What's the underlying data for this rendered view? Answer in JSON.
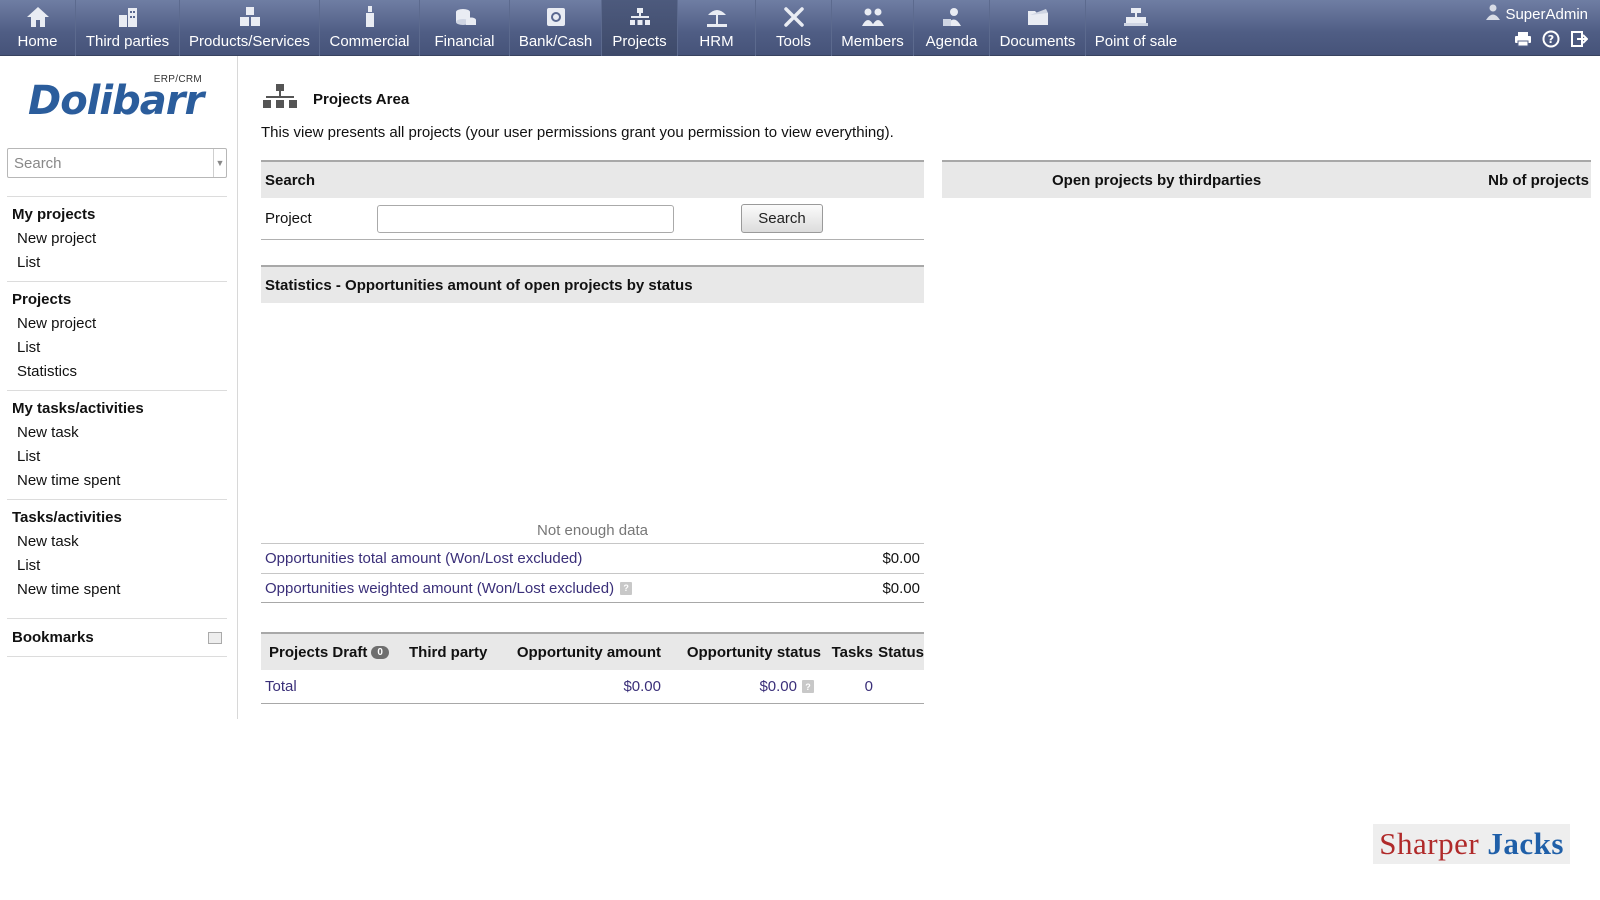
{
  "nav": {
    "items": [
      {
        "label": "Home",
        "icon": "home-icon"
      },
      {
        "label": "Third parties",
        "icon": "building-icon"
      },
      {
        "label": "Products/Services",
        "icon": "boxes-icon"
      },
      {
        "label": "Commercial",
        "icon": "bottle-icon"
      },
      {
        "label": "Financial",
        "icon": "coins-icon"
      },
      {
        "label": "Bank/Cash",
        "icon": "safe-icon"
      },
      {
        "label": "Projects",
        "icon": "org-chart-icon",
        "active": true
      },
      {
        "label": "HRM",
        "icon": "beach-icon"
      },
      {
        "label": "Tools",
        "icon": "wrench-icon"
      },
      {
        "label": "Members",
        "icon": "group-icon"
      },
      {
        "label": "Agenda",
        "icon": "agenda-icon"
      },
      {
        "label": "Documents",
        "icon": "folder-icon"
      },
      {
        "label": "Point of sale",
        "icon": "cash-register-icon"
      }
    ],
    "user": "SuperAdmin"
  },
  "sidebar": {
    "logo_word": "Dolibarr",
    "logo_tag": "ERP/CRM",
    "search_placeholder": "Search",
    "blocks": [
      {
        "title": "My projects",
        "items": [
          "New project",
          "List"
        ]
      },
      {
        "title": "Projects",
        "items": [
          "New project",
          "List",
          "Statistics"
        ]
      },
      {
        "title": "My tasks/activities",
        "items": [
          "New task",
          "List",
          "New time spent"
        ]
      },
      {
        "title": "Tasks/activities",
        "items": [
          "New task",
          "List",
          "New time spent"
        ]
      }
    ],
    "bookmarks": "Bookmarks"
  },
  "main": {
    "title": "Projects Area",
    "intro": "This view presents all projects (your user permissions grant you permission to view everything).",
    "search": {
      "header": "Search",
      "label": "Project",
      "value": "",
      "button": "Search"
    },
    "stats": {
      "header": "Statistics - Opportunities amount of open projects by status",
      "no_data": "Not enough data",
      "rows": [
        {
          "label": "Opportunities total amount (Won/Lost excluded)",
          "value": "$0.00"
        },
        {
          "label": "Opportunities weighted amount (Won/Lost excluded)",
          "value": "$0.00"
        }
      ]
    },
    "draft": {
      "title": "Projects Draft",
      "count": "0",
      "columns": [
        "Third party",
        "Opportunity amount",
        "Opportunity status",
        "Tasks",
        "Status"
      ],
      "total_label": "Total",
      "total_amount": "$0.00",
      "total_status_amount": "$0.00",
      "total_tasks": "0"
    },
    "thirdparties": {
      "col1": "Open projects by thirdparties",
      "col2": "Nb of projects"
    }
  },
  "watermark": {
    "part1": "Sharper",
    "part2": "Jacks"
  },
  "colors": {
    "nav_bg": "#55638a",
    "link": "#3a2f79",
    "logo": "#2b5d9c"
  }
}
